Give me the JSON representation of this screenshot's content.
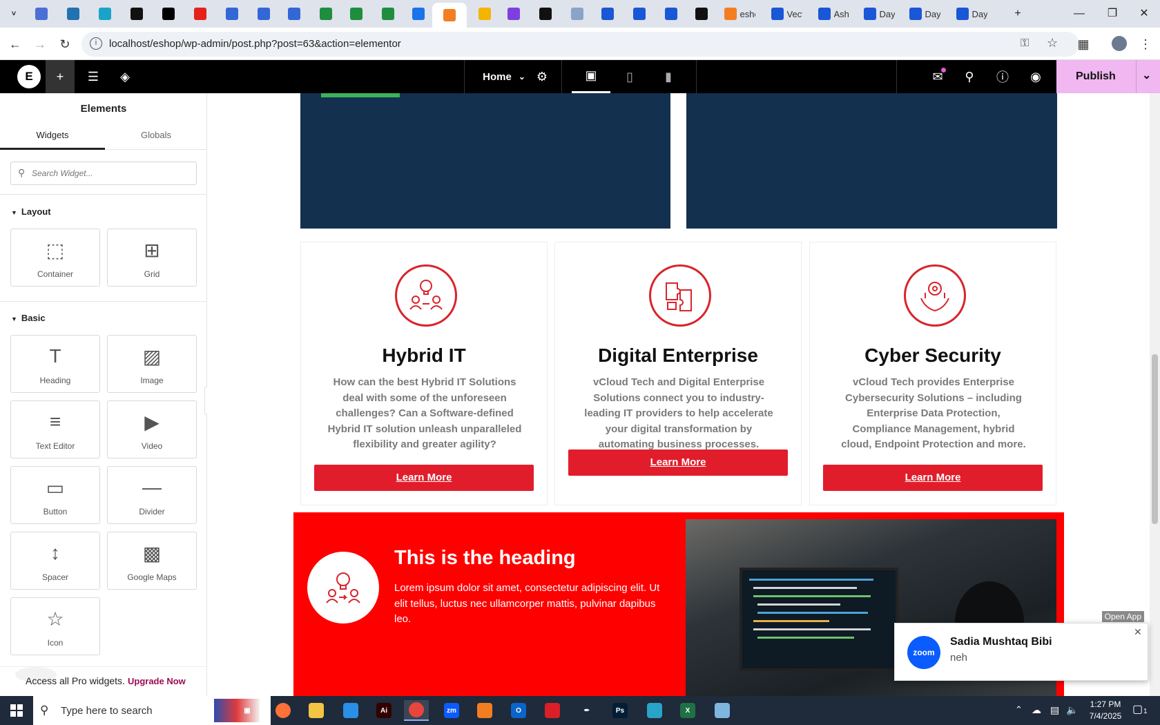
{
  "browser": {
    "tabs": [
      {
        "icon": "chevron-icon",
        "color": "#dfe3eb",
        "title": ""
      },
      {
        "icon": "app-icon",
        "color": "#4a6fd6",
        "title": ""
      },
      {
        "icon": "wp-icon",
        "color": "#2272b1",
        "title": ""
      },
      {
        "icon": "app-icon",
        "color": "#19a3c9",
        "title": ""
      },
      {
        "icon": "app-icon",
        "color": "#111111",
        "title": ""
      },
      {
        "icon": "bolt-icon",
        "color": "#000000",
        "title": ""
      },
      {
        "icon": "youtube-icon",
        "color": "#e62117",
        "title": ""
      },
      {
        "icon": "docs-icon",
        "color": "#3367d6",
        "title": ""
      },
      {
        "icon": "docs-icon",
        "color": "#3367d6",
        "title": ""
      },
      {
        "icon": "docs-icon",
        "color": "#3367d6",
        "title": ""
      },
      {
        "icon": "sheets-icon",
        "color": "#1e8e3e",
        "title": ""
      },
      {
        "icon": "sheets-icon",
        "color": "#1e8e3e",
        "title": ""
      },
      {
        "icon": "sheets-icon",
        "color": "#1e8e3e",
        "title": ""
      },
      {
        "icon": "app-icon",
        "color": "#1a73e8",
        "title": ""
      },
      {
        "icon": "xampp-icon",
        "color": "#f37e22",
        "title": ""
      },
      {
        "icon": "app-icon",
        "color": "#f5b400",
        "title": ""
      },
      {
        "icon": "code-icon",
        "color": "#7f3fe0",
        "title": ""
      },
      {
        "icon": "app-icon",
        "color": "#111111",
        "title": ""
      },
      {
        "icon": "app-icon",
        "color": "#8aa3c8",
        "title": ""
      },
      {
        "icon": "forms-icon",
        "color": "#1a57d6",
        "title": ""
      },
      {
        "icon": "forms-icon",
        "color": "#1a57d6",
        "title": ""
      },
      {
        "icon": "forms-icon",
        "color": "#1a57d6",
        "title": ""
      },
      {
        "icon": "medium-icon",
        "color": "#111111",
        "title": ""
      },
      {
        "icon": "xampp-icon",
        "color": "#f37e22",
        "title": "esho"
      },
      {
        "icon": "forms-icon",
        "color": "#1a57d6",
        "title": "Vect"
      },
      {
        "icon": "forms-icon",
        "color": "#1a57d6",
        "title": "Ash"
      },
      {
        "icon": "forms-icon",
        "color": "#1a57d6",
        "title": "Day"
      },
      {
        "icon": "forms-icon",
        "color": "#1a57d6",
        "title": "Day"
      },
      {
        "icon": "forms-icon",
        "color": "#1a57d6",
        "title": "Day"
      }
    ],
    "new_tab": "+",
    "url": "localhost/eshop/wp-admin/post.php?post=63&action=elementor"
  },
  "elementor": {
    "page_name": "Home",
    "publish_label": "Publish"
  },
  "sidebar": {
    "title": "Elements",
    "tabs": [
      "Widgets",
      "Globals"
    ],
    "search_placeholder": "Search Widget...",
    "sections": [
      {
        "title": "Layout",
        "widgets": [
          "Container",
          "Grid"
        ]
      },
      {
        "title": "Basic",
        "widgets": [
          "Heading",
          "Image",
          "Text Editor",
          "Video",
          "Button",
          "Divider",
          "Spacer",
          "Google Maps",
          "Icon"
        ]
      }
    ],
    "pro_text": "Access all Pro widgets.",
    "upgrade_label": "Upgrade Now"
  },
  "canvas": {
    "cards": [
      {
        "title": "Hybrid IT",
        "text": "How can the best Hybrid IT Solutions deal with some of the unforeseen challenges? Can a Software-defined Hybrid IT solution unleash unparalleled flexibility and greater agility?",
        "button": "Learn More"
      },
      {
        "title": "Digital Enterprise",
        "text": "vCloud Tech and Digital Enterprise Solutions connect you to industry-leading IT providers to help accelerate your digital transformation by automating business processes.",
        "button": "Learn More"
      },
      {
        "title": "Cyber Security",
        "text": "vCloud Tech provides Enterprise Cybersecurity Solutions – including Enterprise Data Protection, Compliance Management, hybrid cloud, Endpoint Protection and more.",
        "button": "Learn More"
      }
    ],
    "feature": {
      "heading": "This is the heading",
      "text": "Lorem ipsum dolor sit amet, consectetur adipiscing elit. Ut elit tellus, luctus nec ullamcorper mattis, pulvinar dapibus leo."
    },
    "colors": {
      "navy": "#14304f",
      "red": "#ff0000",
      "button_red": "#e11d2b"
    }
  },
  "zoom_popup": {
    "open_app": "Open App",
    "name": "Sadia Mushtaq Bibi",
    "message": "neh",
    "logo_text": "zoom"
  },
  "taskbar": {
    "search_placeholder": "Type here to search",
    "time": "1:27 PM",
    "date": "7/4/2025",
    "notification_count": "1"
  }
}
